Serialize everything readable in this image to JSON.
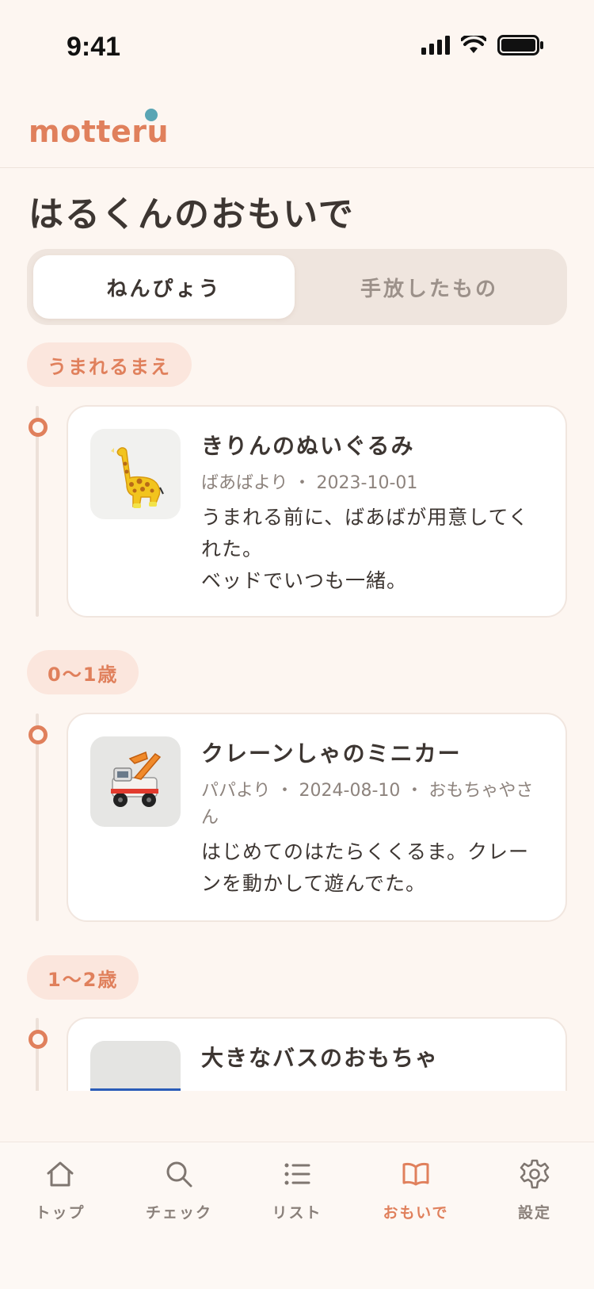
{
  "status_bar": {
    "time": "9:41"
  },
  "header": {
    "logo": "motteru"
  },
  "page": {
    "title": "はるくんのおもいで"
  },
  "segmented": {
    "tab_active": "ねんぴょう",
    "tab_inactive": "手放したもの"
  },
  "sections": [
    {
      "label": "うまれるまえ",
      "items": [
        {
          "title": "きりんのぬいぐるみ",
          "meta": "ばあばより ・ 2023-10-01",
          "desc": "うまれる前に、ばあばが用意してくれた。\nベッドでいつも一緒。",
          "thumb": "giraffe-plush"
        }
      ]
    },
    {
      "label": "0〜1歳",
      "items": [
        {
          "title": "クレーンしゃのミニカー",
          "meta": "パパより ・ 2024-08-10 ・ おもちゃやさん",
          "desc": "はじめてのはたらくくるま。クレーンを動かして遊んでた。",
          "thumb": "crane-minicar"
        }
      ]
    },
    {
      "label": "1〜2歳",
      "items": [
        {
          "title": "大きなバスのおもちゃ",
          "meta": "",
          "desc": "",
          "thumb": "bus-toy"
        }
      ]
    }
  ],
  "nav": [
    {
      "label": "トップ",
      "icon": "home-icon"
    },
    {
      "label": "チェック",
      "icon": "search-icon"
    },
    {
      "label": "リスト",
      "icon": "list-icon"
    },
    {
      "label": "おもいで",
      "icon": "book-icon",
      "active": true
    },
    {
      "label": "設定",
      "icon": "gear-icon"
    }
  ],
  "colors": {
    "accent": "#e0805c",
    "background": "#fdf6f1",
    "logo_dot": "#5aa5b4"
  }
}
